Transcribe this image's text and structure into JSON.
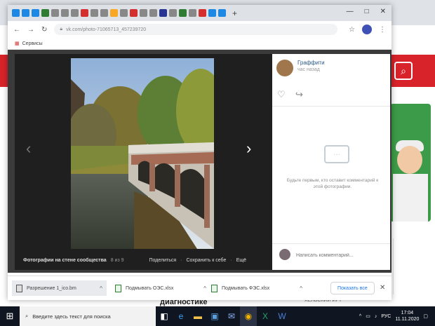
{
  "browser": {
    "tab_count": 22,
    "new_tab_label": "+",
    "window_controls": {
      "minimize": "—",
      "maximize": "□",
      "close": "✕"
    },
    "address": "vk.com/photo-71065713_457239720",
    "bookmarks_label": "Сервисы"
  },
  "viewer": {
    "prev_arrow": "‹",
    "next_arrow": "›",
    "album_label": "Фотографии на стене сообщества",
    "counter": "8 из 9",
    "share_label": "Поделиться",
    "save_label": "Сохранить к себе",
    "more_label": "Ещё"
  },
  "side_panel": {
    "author": "Граффити",
    "subtitle": "час назад",
    "empty_comments": "Будьте первым, кто оставит комментарий к этой фотографии.",
    "comment_placeholder": "Написать комментарий..."
  },
  "downloads": {
    "items": [
      {
        "name": "Разрешение 1_ico.bm"
      },
      {
        "name": "Подмывать ОЭС.xlsx"
      },
      {
        "name": "Подмывать ФЭС.xlsx"
      }
    ],
    "show_all": "Показать все",
    "close": "✕"
  },
  "background_page": {
    "heading": "диагностике",
    "side_text": "ХЕЛЬСКИЙ ИРТ"
  },
  "taskbar": {
    "search_placeholder": "Введите здесь текст для поиска",
    "language": "РУС",
    "time": "17:04",
    "date": "11.11.2020"
  },
  "colors": {
    "brand_red": "#d8232a",
    "vk_link": "#2a5885",
    "taskbar": "#0f1521"
  }
}
